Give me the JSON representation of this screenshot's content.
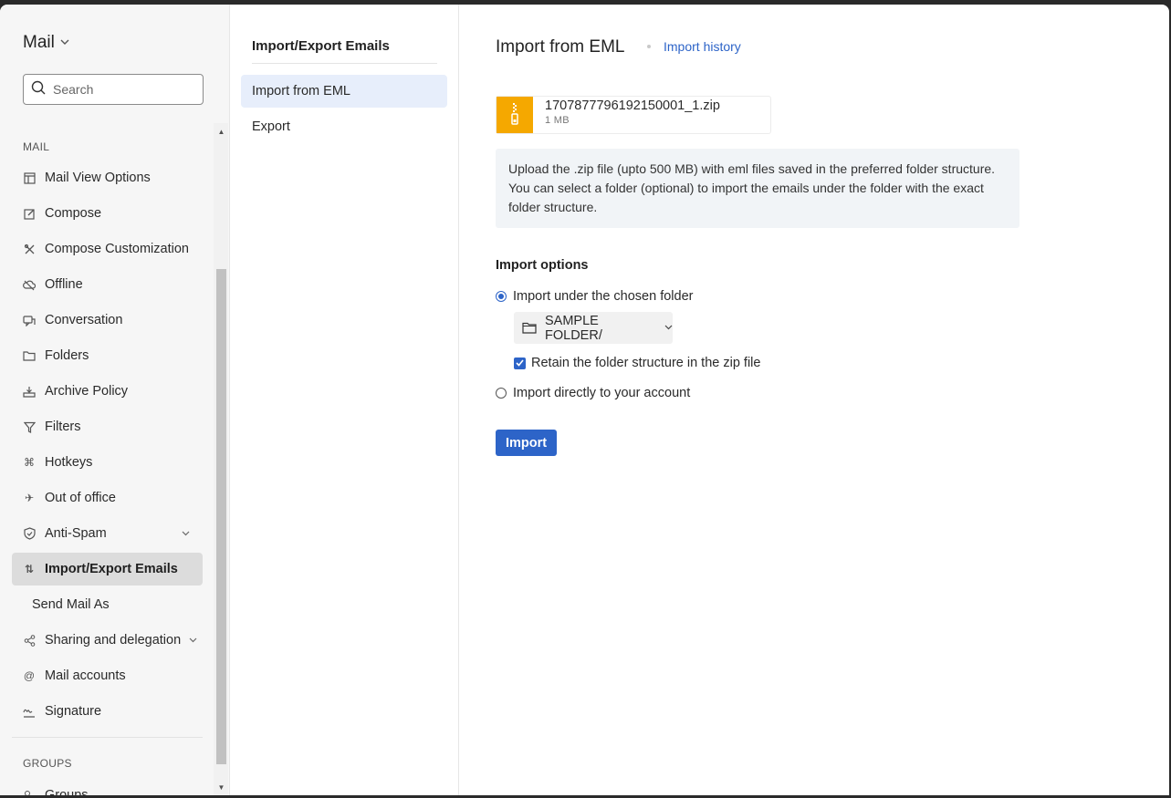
{
  "app": {
    "title": "Mail"
  },
  "search": {
    "placeholder": "Search"
  },
  "sidebar": {
    "section_mail": "MAIL",
    "items": [
      {
        "label": "Mail View Options",
        "icon": "layout-icon"
      },
      {
        "label": "Compose",
        "icon": "pencil-icon"
      },
      {
        "label": "Compose Customization",
        "icon": "tools-icon"
      },
      {
        "label": "Offline",
        "icon": "cloud-off-icon"
      },
      {
        "label": "Conversation",
        "icon": "chat-icon"
      },
      {
        "label": "Folders",
        "icon": "folder-icon"
      },
      {
        "label": "Archive Policy",
        "icon": "archive-icon"
      },
      {
        "label": "Filters",
        "icon": "filter-icon"
      },
      {
        "label": "Hotkeys",
        "icon": "command-icon"
      },
      {
        "label": "Out of office",
        "icon": "airplane-icon"
      },
      {
        "label": "Anti-Spam",
        "icon": "shield-icon"
      },
      {
        "label": "Import/Export Emails",
        "icon": "import-export-icon",
        "active": true
      },
      {
        "label": "Send Mail As",
        "icon": ""
      },
      {
        "label": "Sharing and delegation",
        "icon": "share-icon"
      },
      {
        "label": "Mail accounts",
        "icon": "at-icon"
      },
      {
        "label": "Signature",
        "icon": "signature-icon"
      }
    ],
    "section_groups": "GROUPS",
    "groups_item": "Groups"
  },
  "submenu": {
    "title": "Import/Export Emails",
    "items": [
      {
        "label": "Import from EML",
        "active": true
      },
      {
        "label": "Export"
      }
    ]
  },
  "main": {
    "title": "Import from EML",
    "history_link": "Import history",
    "file": {
      "name": "1707877796192150001_1.zip",
      "size": "1 MB"
    },
    "info_text": "Upload the .zip file (upto 500 MB) with eml files saved in the preferred folder structure. You can select a folder (optional) to import the emails under the folder with the exact folder structure.",
    "options_title": "Import options",
    "option_chosen_folder": "Import under the chosen folder",
    "folder_value": "SAMPLE FOLDER/",
    "retain_label": "Retain the folder structure in the zip file",
    "option_direct": "Import directly to your account",
    "import_button": "Import"
  },
  "colors": {
    "accent": "#2d64c8",
    "zip": "#f5a800"
  }
}
